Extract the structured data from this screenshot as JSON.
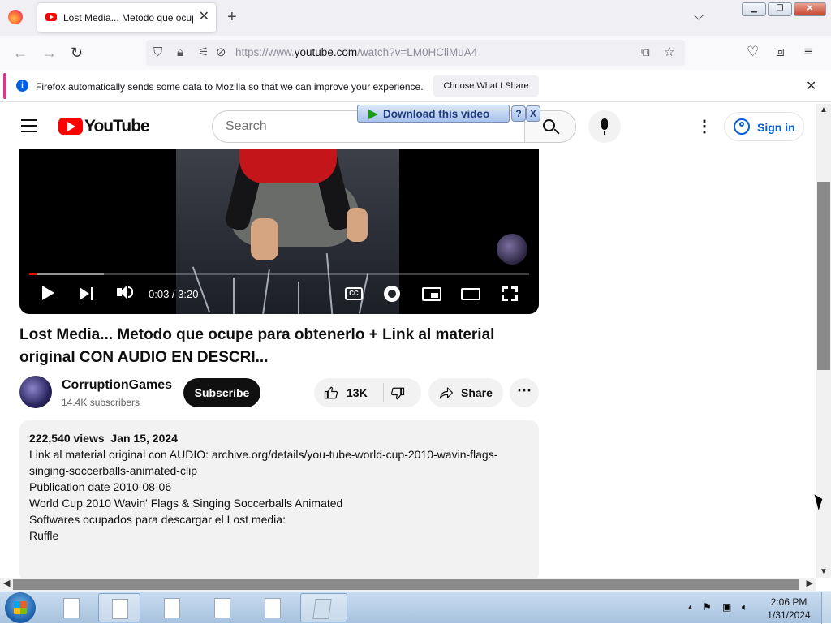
{
  "browser": {
    "tab_title": "Lost Media... Metodo que ocupe para obtenerlo + Link al material original CON AUDIO EN DESCRI...",
    "url_prefix": "https://www.",
    "url_domain": "youtube.com",
    "url_path": "/watch?v=LM0HCliMuA4",
    "notification_text": "Firefox automatically sends some data to Mozilla so that we can improve your experience.",
    "notification_button": "Choose What I Share"
  },
  "youtube": {
    "logo_text": "YouTube",
    "search_placeholder": "Search",
    "signin_label": "Sign in",
    "download_label": "Download this video",
    "download_help": "?",
    "download_close": "X"
  },
  "video": {
    "time_display": "0:03 / 3:20",
    "progress_played": 0.015,
    "progress_loaded": 0.15,
    "cc_label": "CC",
    "title": "Lost Media... Metodo que ocupe para obtenerlo + Link al material original CON AUDIO EN DESCRI...",
    "channel_name": "CorruptionGames",
    "subscribers": "14.4K subscribers",
    "subscribe_label": "Subscribe",
    "likes": "13K",
    "share_label": "Share"
  },
  "description": {
    "views": "222,540 views",
    "date": "Jan 15, 2024",
    "lines": [
      "Link al material original con AUDIO: archive.org/details/you-tube-world-cup-2010-wavin-flags-singing-soccerballs-animated-clip",
      "",
      "Publication date 2010-08-06",
      "World Cup 2010 Wavin' Flags & Singing Soccerballs Animated",
      "",
      "Softwares ocupados para descargar el Lost media:",
      "Ruffle"
    ]
  },
  "taskbar": {
    "clock_time": "2:06 PM",
    "clock_date": "1/31/2024"
  },
  "colors": {
    "yt_red": "#ff0000",
    "signin_blue": "#065fd4",
    "notification_accent": "#d63a8a"
  }
}
